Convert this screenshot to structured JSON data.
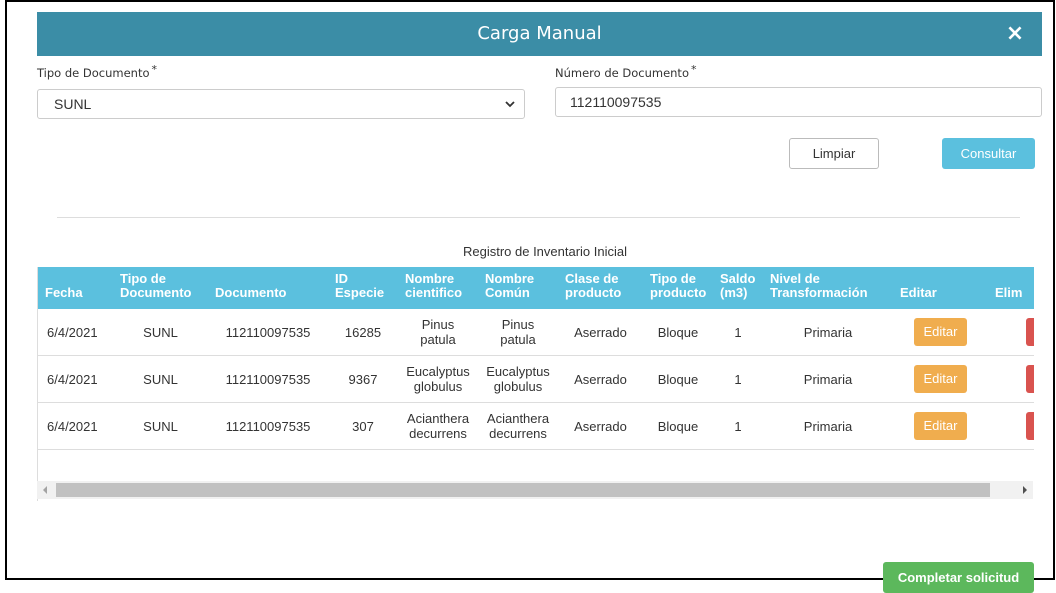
{
  "dialog": {
    "title": "Carga Manual",
    "close_label": "×"
  },
  "form": {
    "tipo_documento": {
      "label": "Tipo de Documento",
      "required_mark": "*",
      "value": "SUNL"
    },
    "numero_documento": {
      "label": "Número de Documento",
      "required_mark": "*",
      "value": "112110097535"
    },
    "limpiar_label": "Limpiar",
    "consultar_label": "Consultar"
  },
  "registro": {
    "title": "Registro de Inventario Inicial",
    "headers": [
      [
        "Fecha"
      ],
      [
        "Tipo de",
        "Documento"
      ],
      [
        "Documento"
      ],
      [
        "ID",
        "Especie"
      ],
      [
        "Nombre",
        "cientifico"
      ],
      [
        "Nombre",
        "Común"
      ],
      [
        "Clase de",
        "producto"
      ],
      [
        "Tipo de",
        "producto"
      ],
      [
        "Saldo",
        "(m3)"
      ],
      [
        "Nivel de",
        "Transformación"
      ],
      [
        "Editar"
      ],
      [
        "Elim"
      ]
    ],
    "rows": [
      {
        "fecha": "6/4/2021",
        "tipo": "SUNL",
        "documento": "112110097535",
        "id_especie": "16285",
        "cientifico": [
          "Pinus",
          "patula"
        ],
        "comun": [
          "Pinus",
          "patula"
        ],
        "clase": "Aserrado",
        "tipo_producto": "Bloque",
        "saldo": "1",
        "nivel": "Primaria",
        "editar": "Editar",
        "eliminar": "×"
      },
      {
        "fecha": "6/4/2021",
        "tipo": "SUNL",
        "documento": "112110097535",
        "id_especie": "9367",
        "cientifico": [
          "Eucalyptus",
          "globulus"
        ],
        "comun": [
          "Eucalyptus",
          "globulus"
        ],
        "clase": "Aserrado",
        "tipo_producto": "Bloque",
        "saldo": "1",
        "nivel": "Primaria",
        "editar": "Editar",
        "eliminar": "×"
      },
      {
        "fecha": "6/4/2021",
        "tipo": "SUNL",
        "documento": "112110097535",
        "id_especie": "307",
        "cientifico": [
          "Acianthera",
          "decurrens"
        ],
        "comun": [
          "Acianthera",
          "decurrens"
        ],
        "clase": "Aserrado",
        "tipo_producto": "Bloque",
        "saldo": "1",
        "nivel": "Primaria",
        "editar": "Editar",
        "eliminar": "×"
      }
    ]
  },
  "completar_label": "Completar solicitud",
  "colors": {
    "header": "#3b8da6",
    "table_header": "#5bc0de",
    "consultar": "#5bc0de",
    "editar": "#f0ad4e",
    "eliminar": "#d9534f",
    "completar": "#5cb85c"
  }
}
